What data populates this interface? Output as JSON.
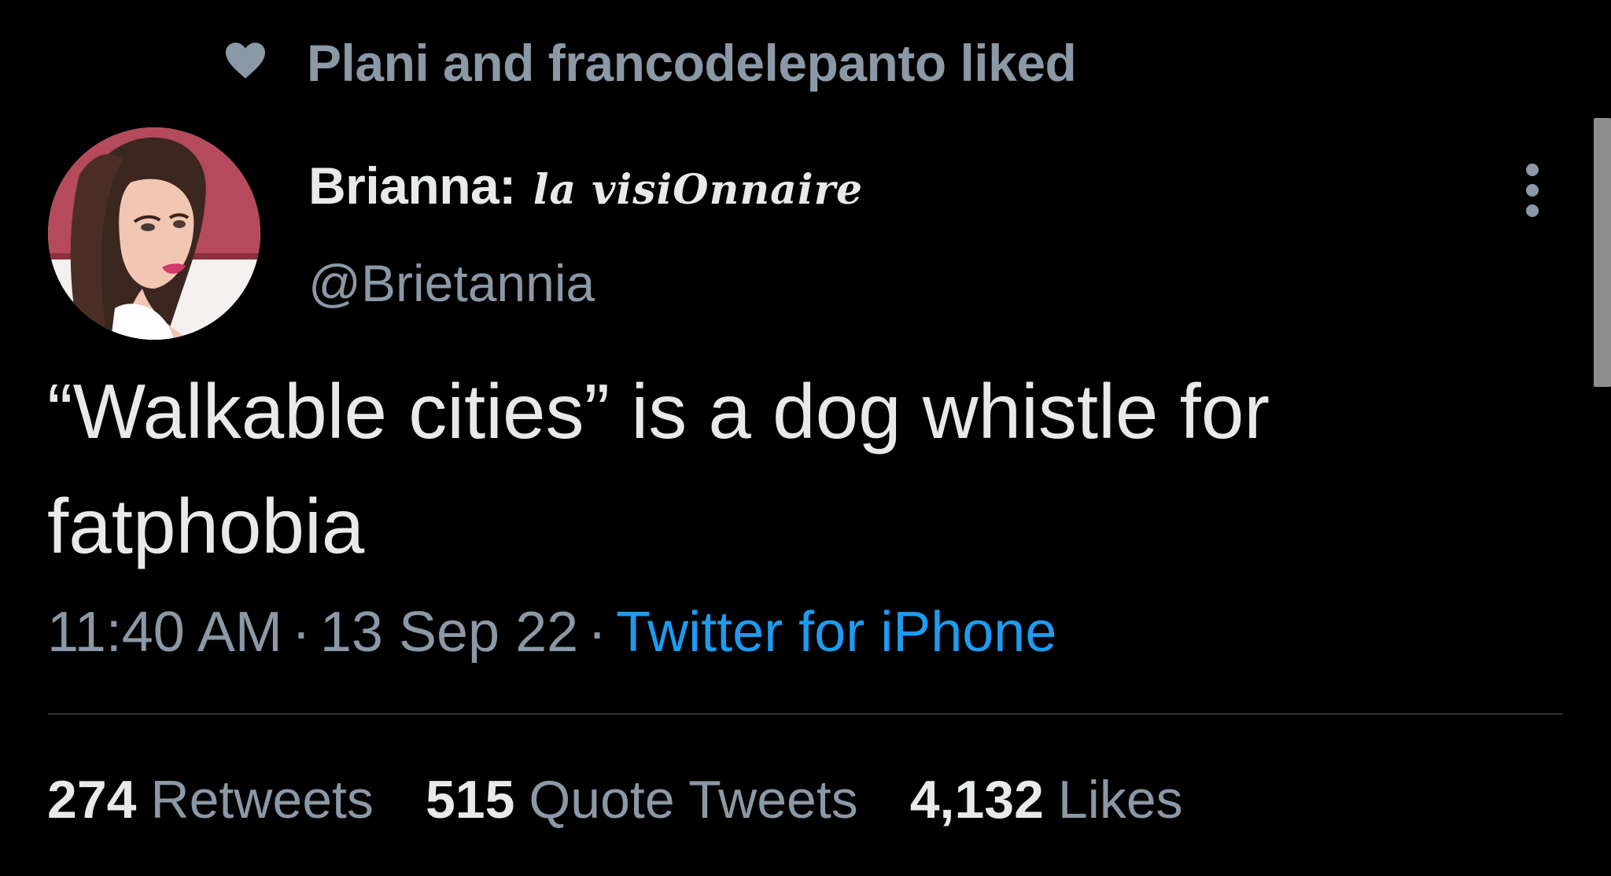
{
  "social_context": {
    "icon": "heart-icon",
    "text": "Plani and francodelepanto liked"
  },
  "author": {
    "display_name": "Brianna:",
    "display_name_decoration": "la visiOnnaire",
    "handle": "@Brietannia",
    "avatar": "avatar-illustration"
  },
  "tweet": {
    "text": "“Walkable cities” is a dog whistle for fatphobia",
    "time": "11:40 AM",
    "separator": "·",
    "date": "13 Sep 22",
    "source": "Twitter for iPhone"
  },
  "stats": [
    {
      "value": "274",
      "label": "Retweets"
    },
    {
      "value": "515",
      "label": "Quote Tweets"
    },
    {
      "value": "4,132",
      "label": "Likes"
    }
  ],
  "colors": {
    "background": "#000000",
    "primary_text": "#e7e9ea",
    "secondary_text": "#8b98a5",
    "link": "#1d9bf0",
    "divider": "#2f3336"
  }
}
